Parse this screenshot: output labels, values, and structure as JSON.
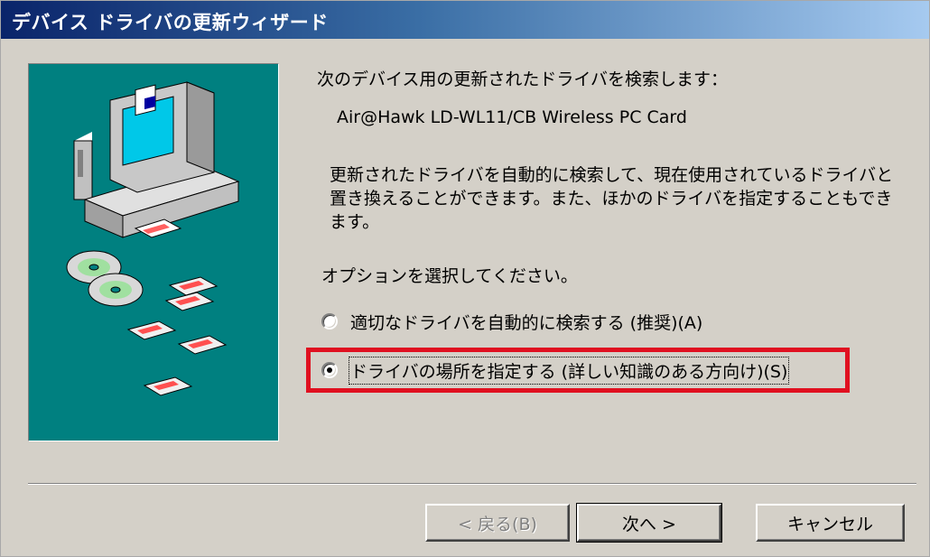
{
  "window": {
    "title": "デバイス ドライバの更新ウィザード"
  },
  "main": {
    "intro": "次のデバイス用の更新されたドライバを検索します：",
    "device_name": "Air@Hawk LD-WL11/CB Wireless PC Card",
    "description": "更新されたドライバを自動的に検索して、現在使用されているドライバと置き換えることができます。また、ほかのドライバを指定することもできます。",
    "prompt": "オプションを選択してください。",
    "options": [
      {
        "label": "適切なドライバを自動的に検索する (推奨)(A)",
        "selected": false
      },
      {
        "label": "ドライバの場所を指定する (詳しい知識のある方向け)(S)",
        "selected": true
      }
    ]
  },
  "buttons": {
    "back": "< 戻る(B)",
    "next": "次へ >",
    "cancel": "キャンセル"
  },
  "colors": {
    "title_start": "#0a246a",
    "title_end": "#a6caf0",
    "art_bg": "#008080",
    "highlight": "#e01020",
    "dialog_bg": "#d4d0c8"
  },
  "icons": [
    "computer-icon",
    "cd-icon",
    "floppy-disk-icon"
  ]
}
